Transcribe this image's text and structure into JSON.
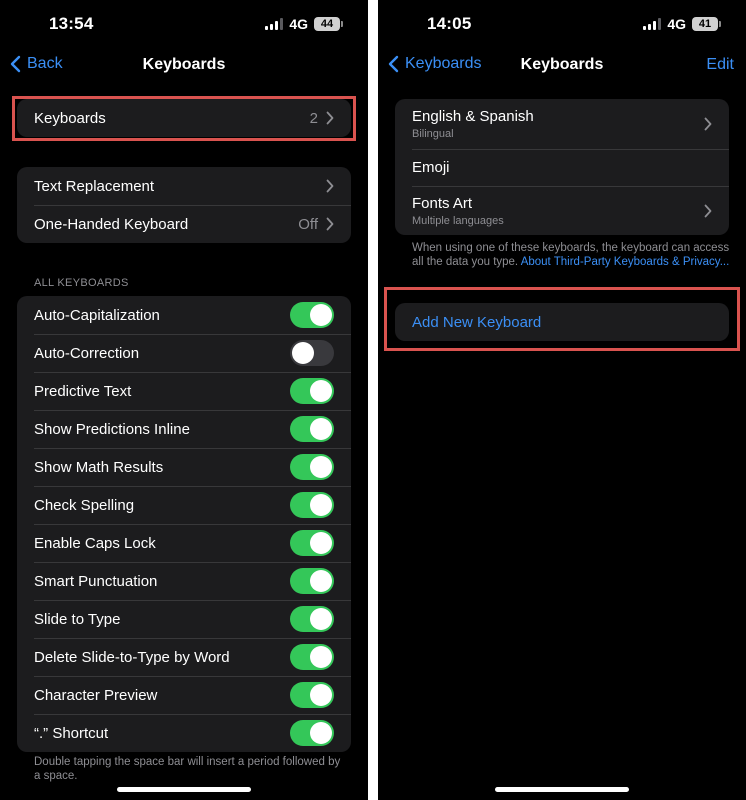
{
  "left": {
    "time": "13:54",
    "network": "4G",
    "battery": "44",
    "nav": {
      "back_label": "Back",
      "title": "Keyboards"
    },
    "keyboards_row": {
      "label": "Keyboards",
      "value": "2"
    },
    "group1": [
      {
        "label": "Text Replacement",
        "value": ""
      },
      {
        "label": "One-Handed Keyboard",
        "value": "Off"
      }
    ],
    "section_header": "ALL KEYBOARDS",
    "toggles": [
      {
        "label": "Auto-Capitalization",
        "on": true
      },
      {
        "label": "Auto-Correction",
        "on": false
      },
      {
        "label": "Predictive Text",
        "on": true
      },
      {
        "label": "Show Predictions Inline",
        "on": true
      },
      {
        "label": "Show Math Results",
        "on": true
      },
      {
        "label": "Check Spelling",
        "on": true
      },
      {
        "label": "Enable Caps Lock",
        "on": true
      },
      {
        "label": "Smart Punctuation",
        "on": true
      },
      {
        "label": "Slide to Type",
        "on": true
      },
      {
        "label": "Delete Slide-to-Type by Word",
        "on": true
      },
      {
        "label": "Character Preview",
        "on": true
      },
      {
        "label": "“.” Shortcut",
        "on": true
      }
    ],
    "footnote": "Double tapping the space bar will insert a period followed by a space."
  },
  "right": {
    "time": "14:05",
    "network": "4G",
    "battery": "41",
    "nav": {
      "back_label": "Keyboards",
      "title": "Keyboards",
      "edit_label": "Edit"
    },
    "keyboards": [
      {
        "name": "English & Spanish",
        "subtitle": "Bilingual",
        "chevron": true
      },
      {
        "name": "Emoji",
        "subtitle": "",
        "chevron": false
      },
      {
        "name": "Fonts Art",
        "subtitle": "Multiple languages",
        "chevron": true
      }
    ],
    "privacy_note": "When using one of these keyboards, the keyboard can access all the data you type.",
    "privacy_link": "About Third-Party Keyboards & Privacy...",
    "add_keyboard": "Add New Keyboard"
  },
  "colors": {
    "accent": "#3b8ff5",
    "toggle_on": "#34c759",
    "toggle_off": "#39393d",
    "highlight": "#d9534f",
    "cell_bg": "#1c1c1e"
  }
}
